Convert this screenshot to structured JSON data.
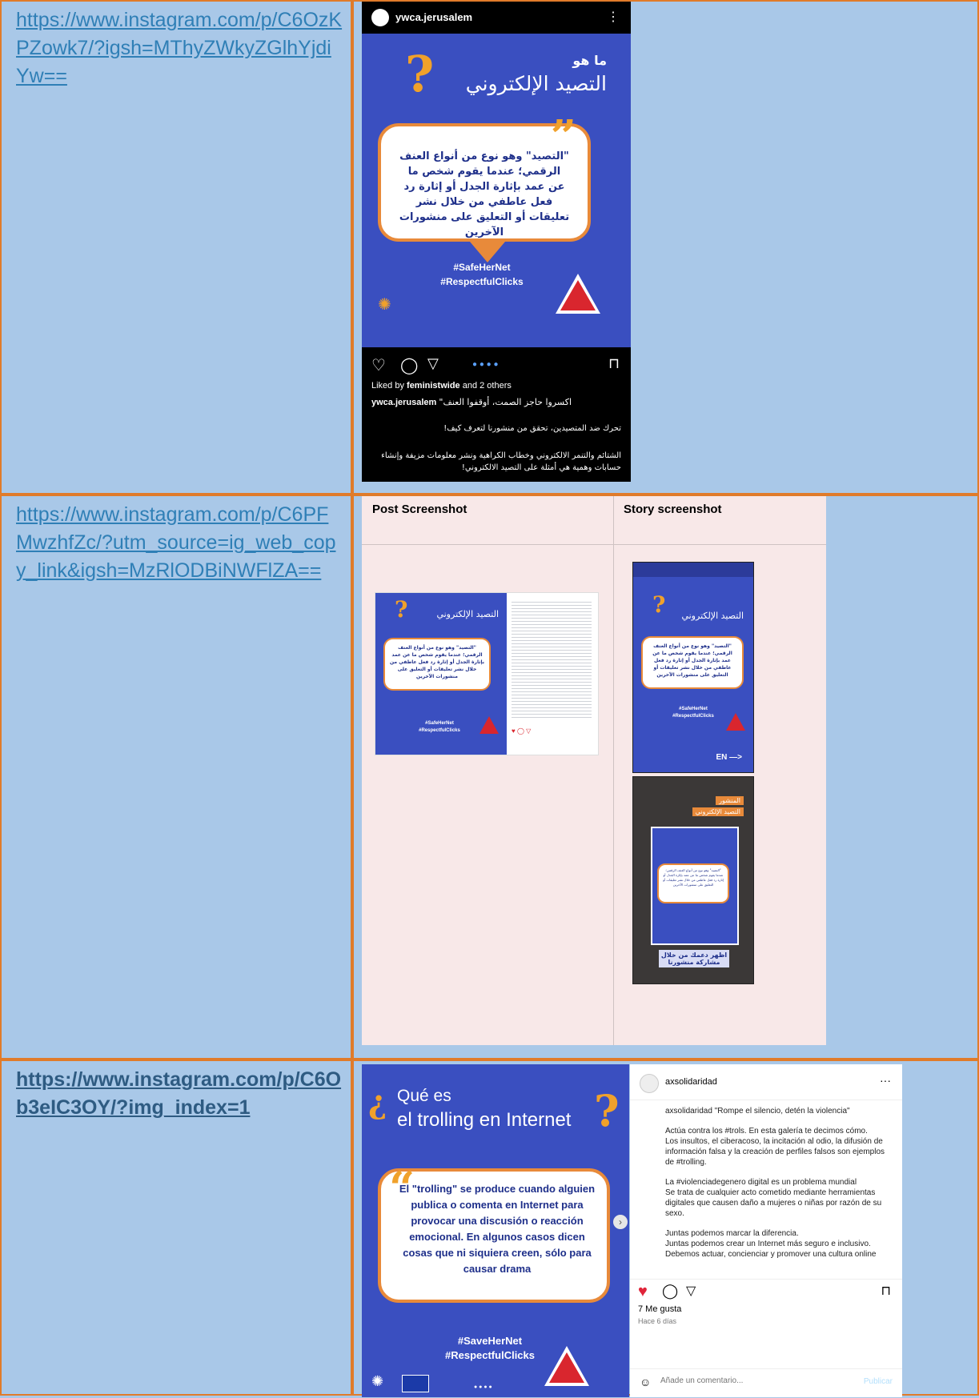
{
  "rows": [
    {
      "link": "https://www.instagram.com/p/C6OzKPZowk7/?igsh=MThyZWkyZGlhYjdiYw=="
    },
    {
      "link": "https://www.instagram.com/p/C6PFMwzhfZc/?utm_source=ig_web_copy_link&igsh=MzRlODBiNWFlZA=="
    },
    {
      "link": "https://www.instagram.com/p/C6Ob3eIC3OY/?img_index=1"
    }
  ],
  "post1": {
    "account": "ywca.jerusalem",
    "title_small": "ما هو",
    "title_big": "التصيد الإلكتروني",
    "quote": "\"التصيد\" وهو نوع من أنواع العنف الرقمي؛ عندما يقوم شخص ما عن عمد بإثارة الجدل أو إثارة رد فعل عاطفي من خلال نشر تعليقات أو التعليق على منشورات الآخرين",
    "hashtag1": "#SafeHerNet",
    "hashtag2": "#RespectfulClicks",
    "liked_prefix": "Liked by ",
    "liked_user": "feministwide",
    "liked_suffix": " and 2 others",
    "caption1": "\"اكسروا حاجز الصمت، أوقفوا العنف",
    "caption2": "تحرك ضد المتصيدين، تحقق من منشورنا لتعرف كيف!",
    "caption3": "الشتائم والتنمر الالكتروني وخطاب الكراهية ونشر معلومات مزيفة وإنشاء حسابات وهمية هي أمثلة على التصيد الالكتروني!"
  },
  "post2": {
    "col1": "Post Screenshot",
    "col2": "Story screenshot",
    "story_en": "EN —>",
    "story2_label1": "المنشور",
    "story2_label2": "التصيد الإلكتروني",
    "story2_cta": "اظهر دعمك من خلال مشاركة منشورنا"
  },
  "post3": {
    "title_line1": "Qué es",
    "title_line2": "el trolling en Internet",
    "quote": "El \"trolling\" se produce cuando alguien publica o comenta en Internet para provocar una discusión o reacción emocional. En algunos casos dicen cosas que ni siquiera creen, sólo para causar drama",
    "hashtag1": "#SaveHerNet",
    "hashtag2": "#RespectfulClicks",
    "account": "axsolidaridad",
    "cap_head": "\"Rompe el silencio, detén la violencia\"",
    "cap_p1": "Actúa contra los #trols. En esta galería te decimos cómo.",
    "cap_p2": "Los insultos, el ciberacoso, la incitación al odio, la difusión de información falsa y la creación de perfiles falsos son ejemplos de #trolling.",
    "cap_p3": "La #violenciadegenero digital es un problema mundial",
    "cap_p3b": "Se trata de cualquier acto cometido mediante herramientas digitales que causen daño a mujeres o niñas por razón de su sexo.",
    "cap_l1": "Juntas podemos marcar la diferencia.",
    "cap_l2": "Juntas podemos crear un Internet más seguro e inclusivo.",
    "cap_l3": "Debemos actuar, concienciar y promover una cultura online",
    "likes": "7 Me gusta",
    "time": "Hace 6 días",
    "comment_placeholder": "Añade un comentario...",
    "publish": "Publicar"
  }
}
